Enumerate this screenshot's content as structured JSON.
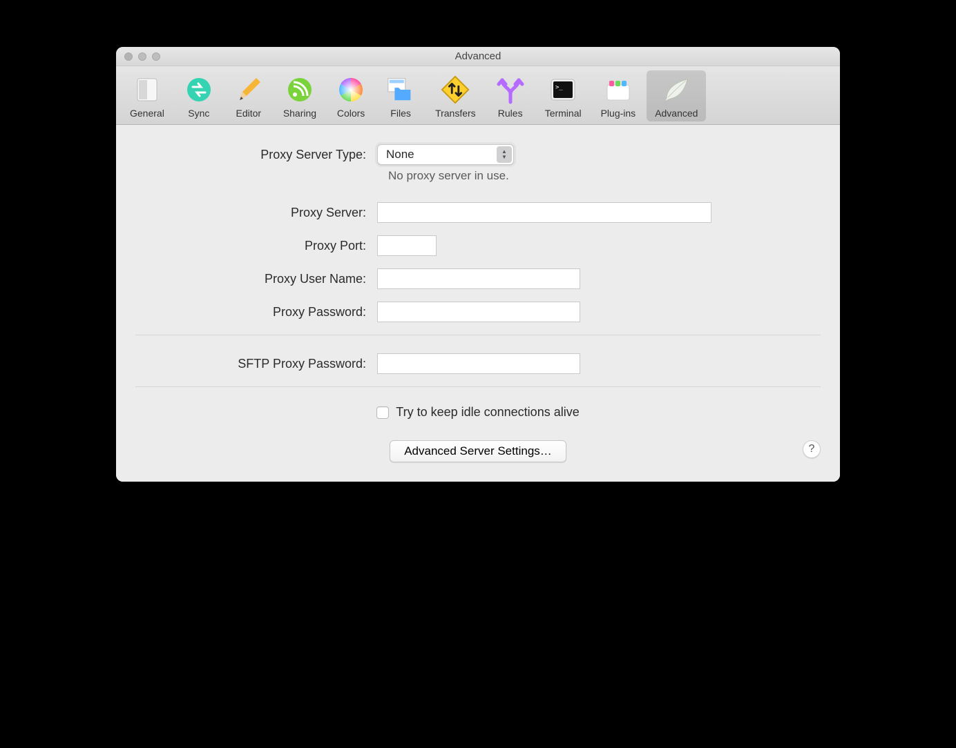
{
  "window": {
    "title": "Advanced"
  },
  "toolbar": {
    "items": [
      {
        "label": "General"
      },
      {
        "label": "Sync"
      },
      {
        "label": "Editor"
      },
      {
        "label": "Sharing"
      },
      {
        "label": "Colors"
      },
      {
        "label": "Files"
      },
      {
        "label": "Transfers"
      },
      {
        "label": "Rules"
      },
      {
        "label": "Terminal"
      },
      {
        "label": "Plug-ins"
      },
      {
        "label": "Advanced"
      }
    ],
    "selected_index": 10
  },
  "form": {
    "proxy_type_label": "Proxy Server Type:",
    "proxy_type_value": "None",
    "proxy_hint": "No proxy server in use.",
    "proxy_server_label": "Proxy Server:",
    "proxy_server_value": "",
    "proxy_port_label": "Proxy Port:",
    "proxy_port_value": "",
    "proxy_user_label": "Proxy User Name:",
    "proxy_user_value": "",
    "proxy_password_label": "Proxy Password:",
    "proxy_password_value": "",
    "sftp_password_label": "SFTP Proxy Password:",
    "sftp_password_value": "",
    "keep_alive_label": "Try to keep idle connections alive",
    "keep_alive_checked": false,
    "advanced_button": "Advanced Server Settings…"
  }
}
